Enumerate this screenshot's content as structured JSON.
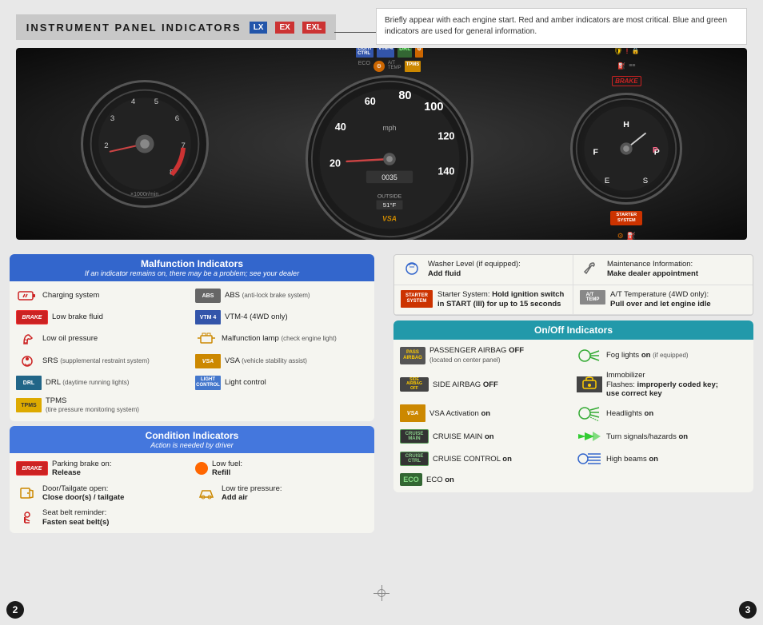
{
  "page": {
    "title": "INSTRUMENT PANEL INDICATORS",
    "badges": [
      "LX",
      "EX",
      "EXL"
    ],
    "info_text": "Briefly appear with each engine start. Red and amber indicators are most critical. Blue and green indicators are used for general information.",
    "page_left": "2",
    "page_right": "3"
  },
  "dashboard": {
    "tach_label": "×1000r/min",
    "speed_label": "mph",
    "odometer": "0035",
    "outside_temp": "51°F"
  },
  "malfunction": {
    "header": "Malfunction Indicators",
    "subheader": "If an indicator remains on, there may be a problem; see your dealer",
    "items": [
      {
        "badge": "battery",
        "text": "Charging system"
      },
      {
        "badge": "ABS",
        "text": "ABS (anti-lock brake system)"
      },
      {
        "badge": "BRAKE",
        "text": "Low brake fluid"
      },
      {
        "badge": "VTM4",
        "text": "VTM-4 (4WD only)"
      },
      {
        "badge": "oil",
        "text": "Low oil pressure"
      },
      {
        "badge": "engine",
        "text": "Malfunction lamp (check engine light)"
      },
      {
        "badge": "SRS",
        "text": "SRS (supplemental restraint system)"
      },
      {
        "badge": "VSA",
        "text": "VSA (vehicle stability assist)"
      },
      {
        "badge": "DRL",
        "text": "DRL (daytime running lights)"
      },
      {
        "badge": "LIGHT CONTROL",
        "text": "Light control"
      },
      {
        "badge": "TPMS",
        "text": "TPMS\n(tire pressure monitoring system)"
      }
    ]
  },
  "condition": {
    "header": "Condition Indicators",
    "subheader": "Action is needed by driver",
    "items": [
      {
        "badge": "BRAKE",
        "text": "Parking brake on:",
        "action": "Release"
      },
      {
        "badge": "fuel",
        "text": "Low fuel:",
        "action": "Refill"
      },
      {
        "badge": "door",
        "text": "Door/Tailgate open:",
        "action": "Close door(s) / tailgate"
      },
      {
        "badge": "tire",
        "text": "Low tire pressure:",
        "action": "Add air"
      },
      {
        "badge": "seatbelt",
        "text": "Seat belt reminder:",
        "action": "Fasten seat belt(s)"
      }
    ]
  },
  "info_indicators": {
    "items": [
      {
        "icon": "washer",
        "text": "Washer Level (if equipped):",
        "action": "Add fluid"
      },
      {
        "icon": "wrench",
        "text": "Maintenance Information:",
        "action": "Make dealer appointment"
      },
      {
        "icon": "starter",
        "text": "Starter System: Hold ignition switch in START (III) for up to 15 seconds",
        "action": ""
      },
      {
        "icon": "at_temp",
        "text": "A/T Temperature (4WD only):",
        "action": "Pull over and let engine idle"
      }
    ]
  },
  "onoff": {
    "header": "On/Off Indicators",
    "items": [
      {
        "icon": "passenger_airbag",
        "text": "PASSENGER AIRBAG OFF",
        "subtext": "(located on center panel)",
        "right": false
      },
      {
        "icon": "fog_light",
        "text": "Fog lights",
        "action": "on",
        "suffix": "(if equipped)",
        "right": true
      },
      {
        "icon": "side_airbag",
        "text": "SIDE AIRBAG OFF",
        "right": false
      },
      {
        "icon": "immobilizer",
        "text": "Immobilizer\nFlashes: improperly coded key; use correct key",
        "right": true
      },
      {
        "icon": "vsa_act",
        "text": "VSA Activation",
        "action": "on",
        "right": false
      },
      {
        "icon": "headlights",
        "text": "Headlights",
        "action": "on",
        "right": true
      },
      {
        "icon": "cruise_main",
        "text": "CRUISE MAIN",
        "action": "on",
        "right": false
      },
      {
        "icon": "turn_signal",
        "text": "Turn signals/hazards",
        "action": "on",
        "right": true
      },
      {
        "icon": "cruise_ctrl",
        "text": "CRUISE CONTROL",
        "action": "on",
        "right": false
      },
      {
        "icon": "high_beam",
        "text": "High beams",
        "action": "on",
        "right": true
      },
      {
        "icon": "eco",
        "text": "ECO",
        "action": "on",
        "right": false
      }
    ]
  }
}
